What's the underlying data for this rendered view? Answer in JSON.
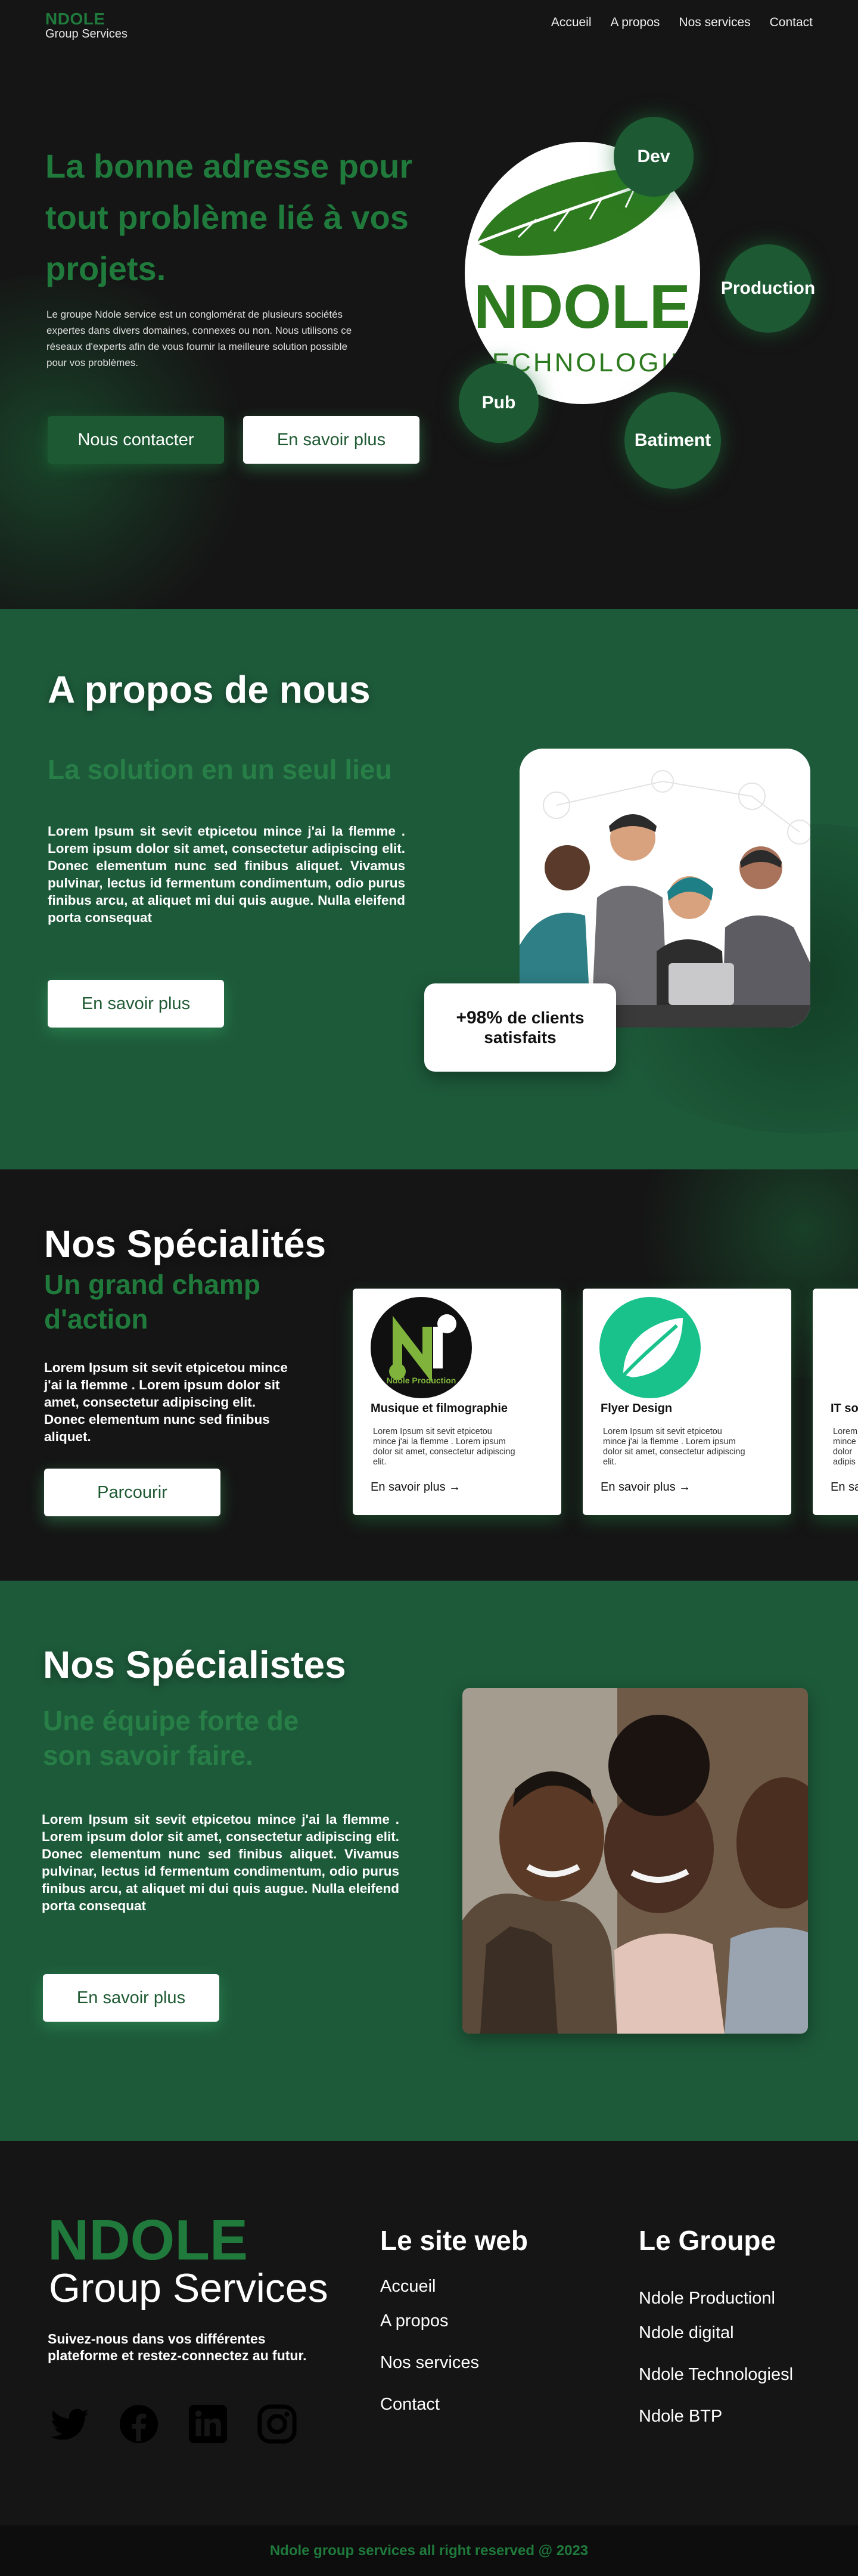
{
  "nav": {
    "brand_name": "NDOLE",
    "brand_sub": "Group Services",
    "links": [
      "Accueil",
      "A propos",
      "Nos services",
      "Contact"
    ]
  },
  "hero": {
    "title": "La bonne adresse pour tout problème lié à vos projets.",
    "description": "Le groupe Ndole service est un conglomérat de plusieurs sociétés expertes dans divers domaines, connexes ou non. Nous utilisons ce réseaux d'experts afin de vous fournir la meilleure solution possible pour vos problèmes.",
    "contact_button": "Nous contacter",
    "more_button": "En savoir plus",
    "logo_word": "NDOLE",
    "logo_subword": "TECHNOLOGIE",
    "bubbles": [
      "Dev",
      "Production",
      "Pub",
      "Batiment"
    ]
  },
  "about": {
    "title": "A propos de nous",
    "subtitle": "La solution en un seul lieu",
    "body": "Lorem Ipsum sit sevit etpicetou mince j'ai la flemme . Lorem ipsum dolor sit amet, consectetur adipiscing elit. Donec elementum nunc sed finibus aliquet. Vivamus pulvinar, lectus id fermentum condimentum, odio purus finibus arcu, at aliquet mi dui quis augue. Nulla eleifend porta consequat",
    "button": "En savoir plus",
    "stat_value": "+98%",
    "stat_label_1": "de clients",
    "stat_label_2": "satisfaits"
  },
  "specialites": {
    "title": "Nos Spécialités",
    "subtitle": "Un grand champ d'action",
    "body": "Lorem Ipsum sit sevit etpicetou mince j'ai la flemme . Lorem ipsum dolor sit amet, consectetur adipiscing elit. Donec elementum nunc sed finibus aliquet.",
    "button": "Parcourir",
    "cards": [
      {
        "title": "Musique et filmographie",
        "logo_text": "Ndole Production",
        "desc": "Lorem Ipsum sit sevit etpicetou mince j'ai la flemme . Lorem ipsum dolor sit amet, consectetur adipiscing elit.",
        "link": "En savoir plus →"
      },
      {
        "title": "Flyer Design",
        "desc": "Lorem Ipsum sit sevit etpicetou mince j'ai la flemme . Lorem ipsum dolor sit amet, consectetur adipiscing elit.",
        "link": "En savoir plus →"
      },
      {
        "title": "IT so",
        "desc": "Lorem mince dolor adipis",
        "link": "En sa"
      }
    ]
  },
  "specialistes": {
    "title": "Nos Spécialistes",
    "subtitle": "Une équipe forte de son savoir faire.",
    "body": "Lorem Ipsum sit sevit etpicetou mince j'ai la flemme . Lorem ipsum dolor sit amet, consectetur adipiscing elit. Donec elementum nunc sed finibus aliquet. Vivamus pulvinar, lectus id fermentum condimentum, odio purus finibus arcu, at aliquet mi dui quis augue. Nulla eleifend porta consequat",
    "button": "En savoir plus"
  },
  "footer": {
    "brand_name": "NDOLE",
    "brand_sub": "Group Services",
    "tagline": "Suivez-nous dans vos différentes plateforme et restez-connectez au futur.",
    "site_title": "Le site web",
    "site_links": [
      "Accueil",
      "A propos",
      "Nos services",
      "Contact"
    ],
    "group_title": "Le Groupe",
    "group_links": [
      "Ndole Productionl",
      "Ndole digital",
      "Ndole Technologiesl",
      "Ndole BTP"
    ],
    "copyright": "Ndole group services all right reserved @ 2023"
  },
  "colors": {
    "brand_green": "#1f7a3c",
    "section_green": "#1d5a3a",
    "dark": "#151515"
  },
  "icons": [
    "twitter-icon",
    "facebook-icon",
    "linkedin-icon",
    "instagram-icon",
    "arrow-right-icon"
  ]
}
